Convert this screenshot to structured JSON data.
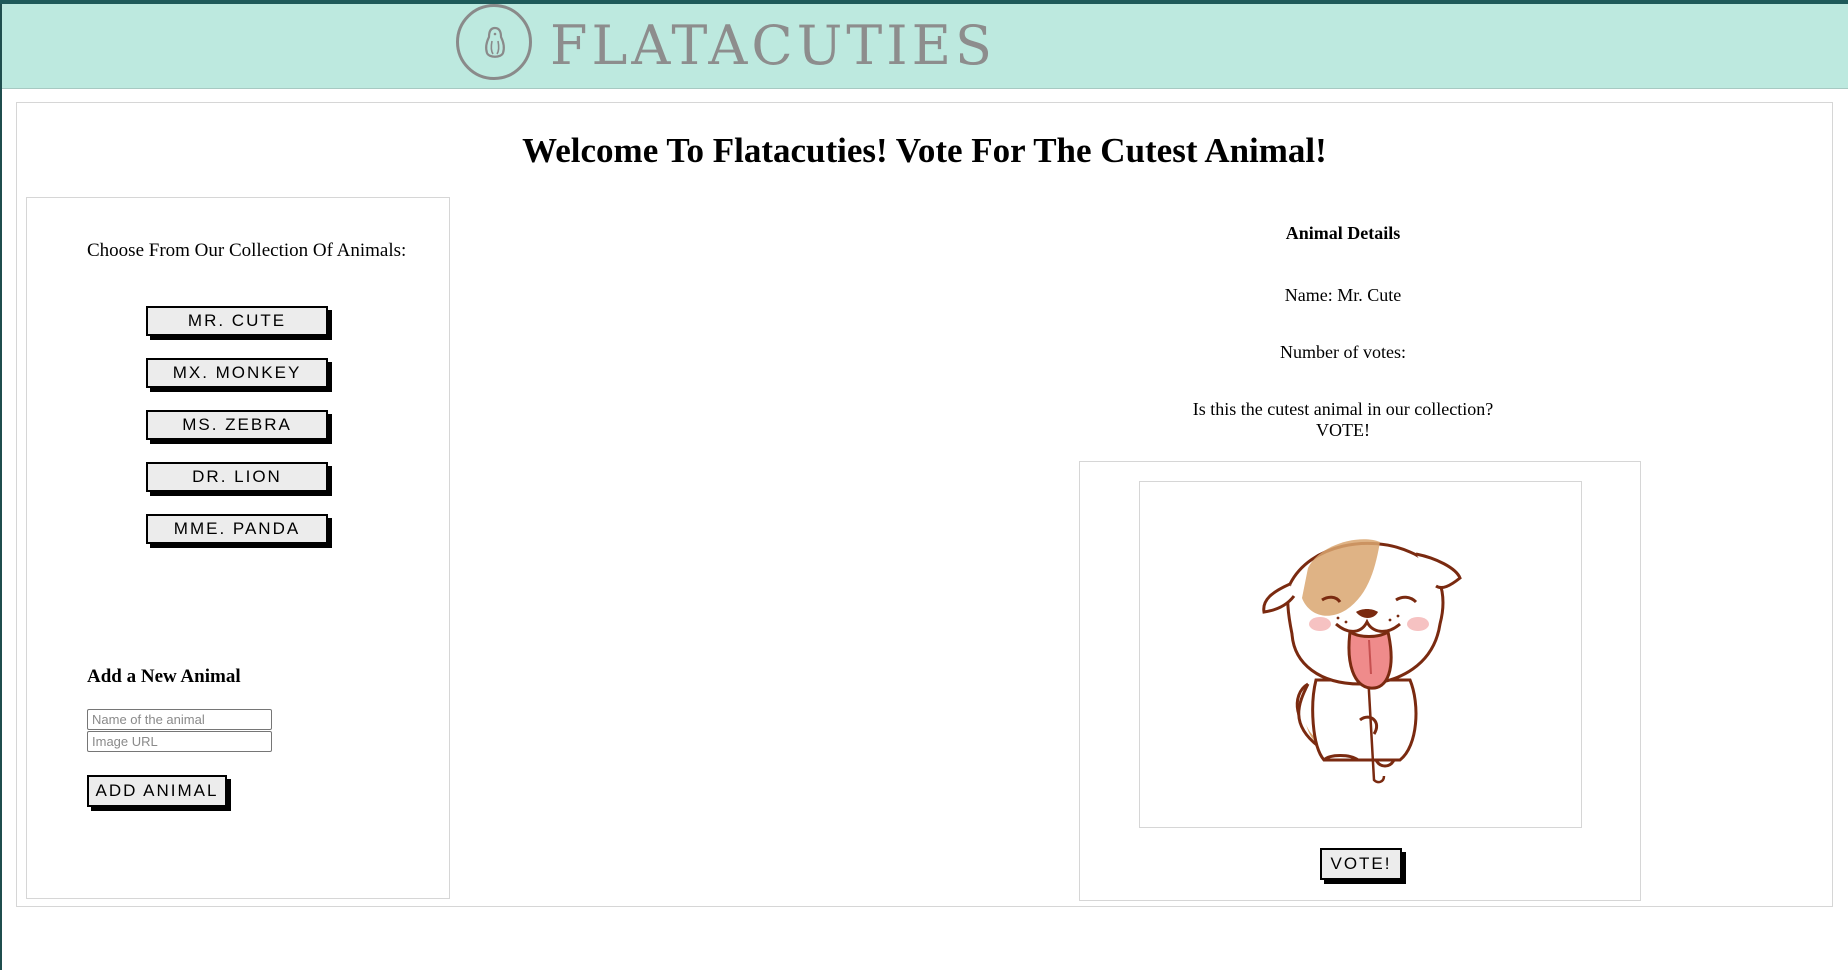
{
  "header": {
    "brand": "FLATACUTIES",
    "logo_icon": "penguin-icon"
  },
  "main": {
    "title": "Welcome To Flatacuties! Vote For The Cutest Animal!"
  },
  "collection": {
    "label": "Choose From Our Collection Of Animals:",
    "animals": [
      {
        "label": "MR. CUTE"
      },
      {
        "label": "MX. MONKEY"
      },
      {
        "label": "MS. ZEBRA"
      },
      {
        "label": "DR. LION"
      },
      {
        "label": "MME. PANDA"
      }
    ]
  },
  "add_form": {
    "heading": "Add a New Animal",
    "name_placeholder": "Name of the animal",
    "name_value": "",
    "url_placeholder": "Image URL",
    "url_value": "",
    "submit_label": "ADD ANIMAL"
  },
  "details": {
    "title": "Animal Details",
    "name_text": "Name: Mr. Cute",
    "votes_text": "Number of votes:",
    "question_line1": "Is this the cutest animal in our collection?",
    "question_line2": "VOTE!",
    "image_icon": "puppy-illustration",
    "vote_label": "VOTE!"
  },
  "colors": {
    "header_bg": "#bde9df",
    "top_strip": "#1f5a5a",
    "logo_gray": "#8d8d8d",
    "button_bg": "#ececec"
  }
}
